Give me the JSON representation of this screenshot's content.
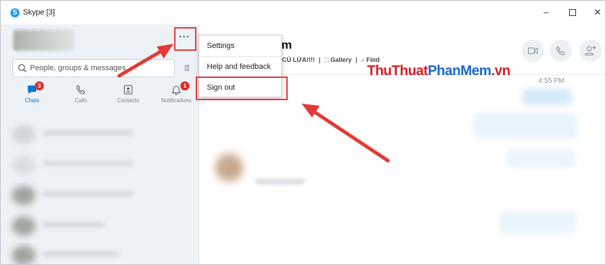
{
  "window": {
    "title": "Skype [3]",
    "logo_letter": "S",
    "controls": {
      "minimize": "–",
      "maximize": "□",
      "close": "✕"
    }
  },
  "sidebar": {
    "more_label": "···",
    "search": {
      "placeholder": "People, groups & messages"
    },
    "dialpad_label": "⁞⁞⁞",
    "nav": [
      {
        "label": "Chats",
        "icon": "chat-icon",
        "badge": "3",
        "active": true
      },
      {
        "label": "Calls",
        "icon": "phone-icon"
      },
      {
        "label": "Contacts",
        "icon": "contacts-icon"
      },
      {
        "label": "Notifications",
        "icon": "bell-icon",
        "badge": "1"
      }
    ]
  },
  "menu": {
    "items": [
      {
        "label": "Settings"
      },
      {
        "label": "Help and feedback"
      },
      {
        "label": "Sign out"
      }
    ]
  },
  "conversation": {
    "title": "m",
    "subtitle": {
      "part1": "CÚ LỪA!!!!",
      "separator": "|",
      "gallery": "Gallery",
      "find": "Find"
    },
    "time": "4:55 PM"
  },
  "watermark": {
    "part1": "ThuThuat",
    "part2": "PhanMem",
    "part3": ".vn"
  },
  "colors": {
    "accent": "#0078d4",
    "badge": "#d93025",
    "highlight_red": "#e53935",
    "watermark_red": "#d32027",
    "watermark_blue": "#1a68c8"
  }
}
